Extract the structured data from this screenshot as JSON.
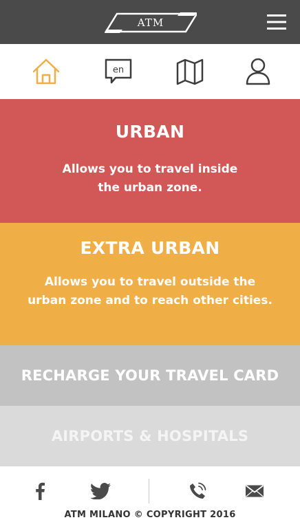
{
  "header": {
    "logo_text": "ATM",
    "menu_icon": "hamburger-menu-icon",
    "background": "#4a4a4a"
  },
  "nav": {
    "items": [
      {
        "icon": "home-icon",
        "active": true
      },
      {
        "icon": "language-icon",
        "label": "en"
      },
      {
        "icon": "map-icon"
      },
      {
        "icon": "user-icon"
      }
    ],
    "active_color": "#f0ae47",
    "icon_color": "#3c3c3c"
  },
  "panels": {
    "urban": {
      "title": "URBAN",
      "description": "Allows you to travel inside\nthe urban zone.",
      "color": "#d15856"
    },
    "extra_urban": {
      "title": "EXTRA URBAN",
      "description": "Allows you to travel outside the\nurban zone and to reach other cities.",
      "color": "#f0ae47"
    },
    "recharge": {
      "label": "RECHARGE YOUR TRAVEL CARD",
      "color": "#c2c2c2"
    },
    "airports": {
      "label": "AIRPORTS & HOSPITALS",
      "color": "#dadada"
    }
  },
  "footer": {
    "social": [
      "facebook-icon",
      "twitter-icon",
      "phone-icon",
      "mail-icon"
    ],
    "copyright": "ATM MILANO © COPYRIGHT 2016"
  }
}
